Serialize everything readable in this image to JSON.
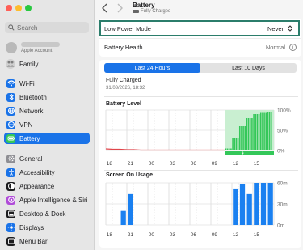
{
  "sidebar": {
    "search_placeholder": "Search",
    "account_subtitle": "Apple Account",
    "family_label": "Family",
    "items": [
      {
        "label": "Wi-Fi",
        "icon": "wifi-icon",
        "color": "#1a73e8"
      },
      {
        "label": "Bluetooth",
        "icon": "bluetooth-icon",
        "color": "#1a73e8"
      },
      {
        "label": "Network",
        "icon": "globe-icon",
        "color": "#1a73e8"
      },
      {
        "label": "VPN",
        "icon": "vpn-icon",
        "color": "#1a73e8"
      },
      {
        "label": "Battery",
        "icon": "battery-icon",
        "color": "#34c759",
        "selected": true
      },
      {
        "label": "General",
        "icon": "gear-icon",
        "color": "#8e8e93"
      },
      {
        "label": "Accessibility",
        "icon": "accessibility-icon",
        "color": "#1a73e8"
      },
      {
        "label": "Appearance",
        "icon": "appearance-icon",
        "color": "#1d1d1f"
      },
      {
        "label": "Apple Intelligence & Siri",
        "icon": "siri-icon",
        "color": "#b04cd8"
      },
      {
        "label": "Desktop & Dock",
        "icon": "dock-icon",
        "color": "#1d1d1f"
      },
      {
        "label": "Displays",
        "icon": "sun-icon",
        "color": "#1a73e8"
      },
      {
        "label": "Menu Bar",
        "icon": "menubar-icon",
        "color": "#1d1d1f"
      }
    ]
  },
  "header": {
    "title": "Battery",
    "subtitle": "Fully Charged"
  },
  "settings": {
    "low_power_label": "Low Power Mode",
    "low_power_value": "Never",
    "health_label": "Battery Health",
    "health_value": "Normal"
  },
  "tabs": {
    "left": "Last 24 Hours",
    "right": "Last 10 Days",
    "active": "Last 24 Hours"
  },
  "status": {
    "title": "Fully Charged",
    "date": "31/03/2026, 18:32"
  },
  "colors": {
    "accent": "#1a73e8",
    "charge_green": "#34c759",
    "low_red": "#e0454b",
    "usage_blue": "#1a80f0"
  },
  "chart_data": [
    {
      "type": "area",
      "title": "Battery Level",
      "x_ticks": [
        "18",
        "21",
        "00",
        "03",
        "06",
        "09",
        "12",
        "15"
      ],
      "y_ticks": [
        "100%",
        "50%",
        "0%"
      ],
      "ylim": [
        0,
        100
      ],
      "level_points": [
        [
          0,
          4
        ],
        [
          1,
          3
        ],
        [
          2,
          3
        ],
        [
          3,
          2
        ],
        [
          4,
          2
        ],
        [
          5,
          1
        ],
        [
          6,
          1
        ],
        [
          7,
          1
        ],
        [
          8,
          1
        ],
        [
          9,
          1
        ],
        [
          10,
          1
        ],
        [
          11,
          1
        ],
        [
          12,
          1
        ],
        [
          13,
          1
        ],
        [
          14,
          1
        ],
        [
          15,
          1
        ],
        [
          16,
          1
        ],
        [
          17,
          1
        ],
        [
          18,
          5
        ],
        [
          19,
          30
        ],
        [
          20,
          60
        ],
        [
          21,
          80
        ],
        [
          22,
          90
        ],
        [
          23,
          93
        ],
        [
          24,
          94
        ],
        [
          25,
          94
        ]
      ],
      "charging_hours": [
        18,
        19,
        20,
        21,
        22,
        23,
        24,
        25
      ],
      "grid": true
    },
    {
      "type": "bar",
      "title": "Screen On Usage",
      "x_ticks": [
        "18",
        "21",
        "00",
        "03",
        "06",
        "09",
        "12",
        "15"
      ],
      "y_ticks": [
        "60m",
        "30m",
        "0m"
      ],
      "ylim": [
        0,
        60
      ],
      "bars": [
        {
          "hour": 3,
          "value": 20
        },
        {
          "hour": 4,
          "value": 44
        },
        {
          "hour": 19,
          "value": 52
        },
        {
          "hour": 20,
          "value": 58
        },
        {
          "hour": 21,
          "value": 44
        },
        {
          "hour": 22,
          "value": 60
        },
        {
          "hour": 23,
          "value": 60
        },
        {
          "hour": 24,
          "value": 60
        }
      ],
      "grid": true
    }
  ]
}
